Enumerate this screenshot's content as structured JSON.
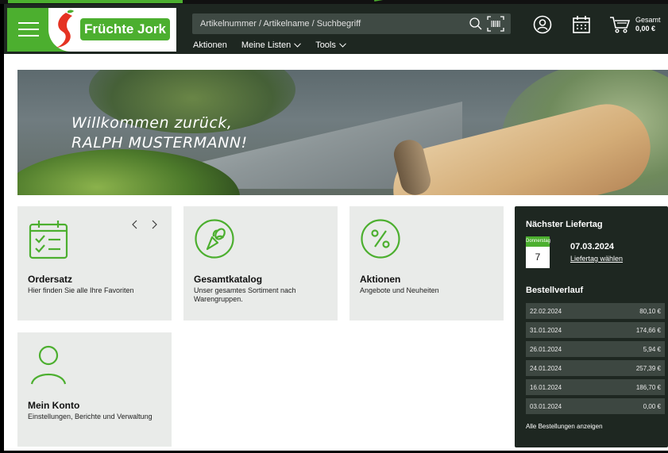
{
  "header": {
    "logo_text": "Früchte Jork",
    "search": {
      "placeholder": "Artikelnummer / Artikelname / Suchbegriff"
    },
    "nav": [
      {
        "label": "Aktionen",
        "has_dropdown": false
      },
      {
        "label": "Meine Listen",
        "has_dropdown": true
      },
      {
        "label": "Tools",
        "has_dropdown": true
      }
    ],
    "cart": {
      "label": "Gesamt",
      "total": "0,00 €"
    },
    "icons": [
      "menu-icon",
      "search-icon",
      "barcode-scan-icon",
      "user-icon",
      "calendar-icon",
      "cart-icon"
    ]
  },
  "hero": {
    "greeting_line1": "Willkommen zurück,",
    "greeting_line2": "RALPH MUSTERMANN!"
  },
  "tiles": [
    {
      "title": "Ordersatz",
      "description": "Hier finden Sie alle Ihre Favoriten",
      "icon": "calendar-check-icon"
    },
    {
      "title": "Gesamtkatalog",
      "description": "Unser gesamtes Sortiment nach Warengruppen.",
      "icon": "vegetables-icon"
    },
    {
      "title": "Aktionen",
      "description": "Angebote und Neuheiten",
      "icon": "percent-icon"
    },
    {
      "title": "Mein Konto",
      "description": "Einstellungen, Berichte und Verwaltung",
      "icon": "user-icon"
    }
  ],
  "delivery": {
    "heading": "Nächster Liefertag",
    "weekday": "Donnerstag",
    "day": "7",
    "date": "07.03.2024",
    "link": "Liefertag wählen"
  },
  "orders": {
    "heading": "Bestellverlauf",
    "items": [
      {
        "date": "22.02.2024",
        "amount": "80,10 €"
      },
      {
        "date": "31.01.2024",
        "amount": "174,66 €"
      },
      {
        "date": "26.01.2024",
        "amount": "5,94 €"
      },
      {
        "date": "24.01.2024",
        "amount": "257,39 €"
      },
      {
        "date": "16.01.2024",
        "amount": "186,70 €"
      },
      {
        "date": "03.01.2024",
        "amount": "0,00 €"
      }
    ],
    "all_link": "Alle Bestellungen anzeigen"
  },
  "colors": {
    "brand_green": "#4caf2f",
    "header_dark": "#1e2721",
    "tile_bg": "#e9ebe9"
  }
}
